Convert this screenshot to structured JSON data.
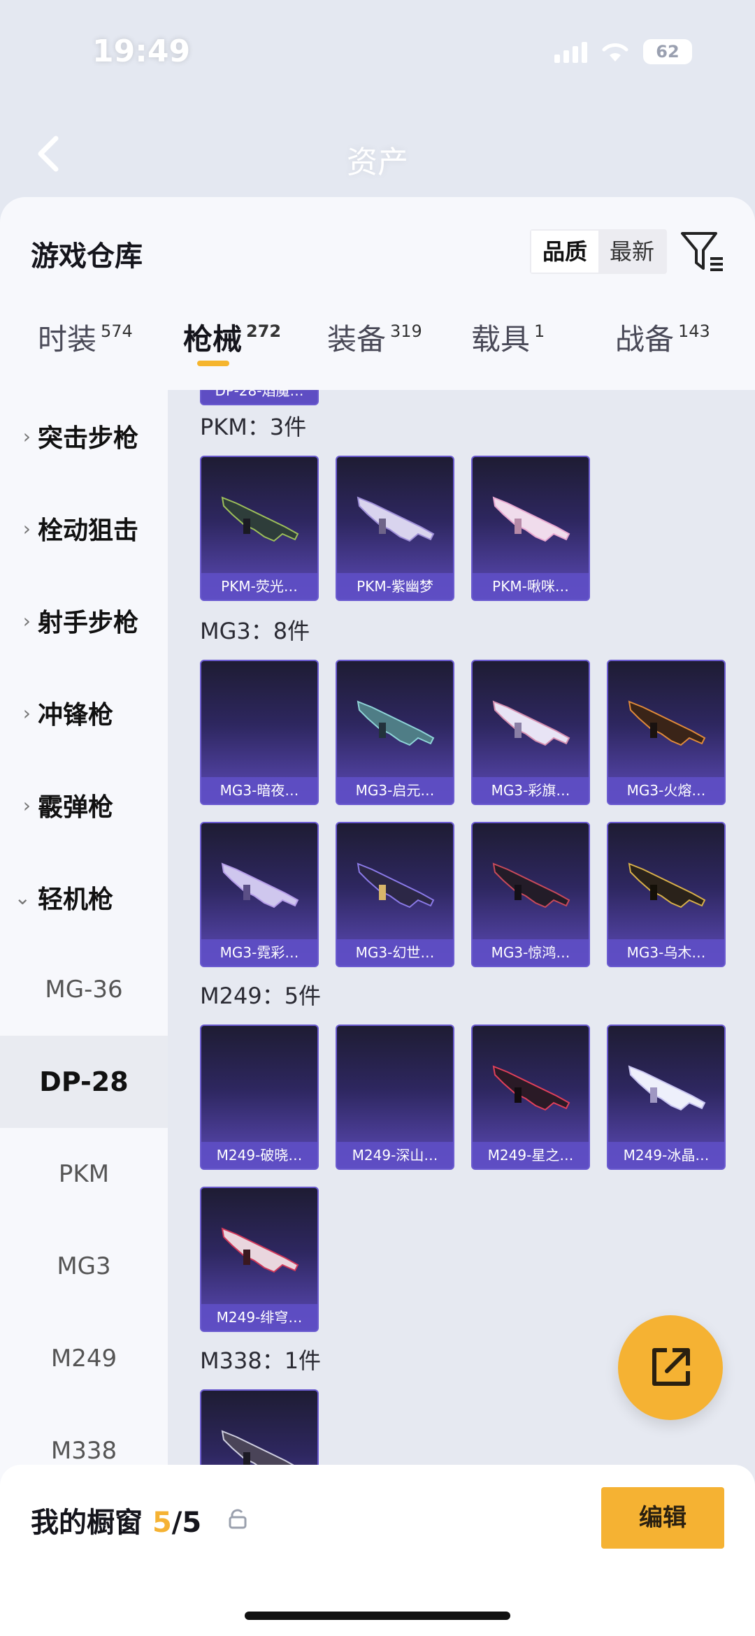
{
  "status": {
    "time": "19:49",
    "battery": "62"
  },
  "header": {
    "title": "资产"
  },
  "sheet": {
    "title": "游戏仓库",
    "sort": [
      "品质",
      "最新"
    ],
    "tabs": [
      {
        "label": "时装",
        "count": "574"
      },
      {
        "label": "枪械",
        "count": "272"
      },
      {
        "label": "装备",
        "count": "319"
      },
      {
        "label": "载具",
        "count": "1"
      },
      {
        "label": "战备",
        "count": "143"
      }
    ]
  },
  "categories": [
    "突击步枪",
    "栓动狙击",
    "射手步枪",
    "冲锋枪",
    "霰弹枪",
    "轻机枪"
  ],
  "subcategories": [
    "MG-36",
    "DP-28",
    "PKM",
    "MG3",
    "M249",
    "M338"
  ],
  "groups": [
    {
      "title": "PKM：3件",
      "items": [
        "PKM-荧光…",
        "PKM-紫幽梦",
        "PKM-啾咪…"
      ]
    },
    {
      "title": "MG3：8件",
      "items": [
        "MG3-暗夜…",
        "MG3-启元…",
        "MG3-彩旗…",
        "MG3-火熔…",
        "MG3-霓彩…",
        "MG3-幻世…",
        "MG3-惊鸿…",
        "MG3-乌木…"
      ]
    },
    {
      "title": "M249：5件",
      "items": [
        "M249-破晓…",
        "M249-深山…",
        "M249-星之…",
        "M249-冰晶…",
        "M249-绯穹…"
      ]
    },
    {
      "title": "M338：1件"
    }
  ],
  "partial_item": "DP-28-焰魔…",
  "bottom": {
    "label": "我的橱窗",
    "count": "5",
    "total": "/5",
    "edit": "编辑"
  },
  "colors": {
    "accent": "#f5b233",
    "card_label": "#5e4ec4"
  }
}
